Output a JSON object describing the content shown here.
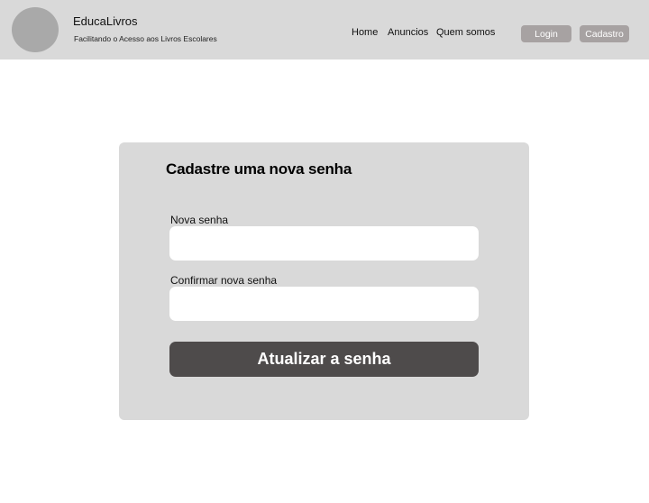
{
  "header": {
    "brand_title": "EducaLivros",
    "brand_subtitle": "Facilitando o Acesso aos Livros Escolares",
    "nav": [
      "Home",
      "Anuncios",
      "Quem somos"
    ],
    "login_label": "Login",
    "cadastro_label": "Cadastro"
  },
  "form": {
    "title": "Cadastre uma nova senha",
    "new_password_label": "Nova senha",
    "new_password_value": "",
    "confirm_password_label": "Confirmar nova senha",
    "confirm_password_value": "",
    "submit_label": "Atualizar a senha"
  },
  "colors": {
    "header_bg": "#d9d9d9",
    "card_bg": "#d9d9d9",
    "header_button_bg": "#a7a2a2",
    "submit_bg": "#4e4b4b",
    "logo_placeholder": "#a9a9a9"
  }
}
